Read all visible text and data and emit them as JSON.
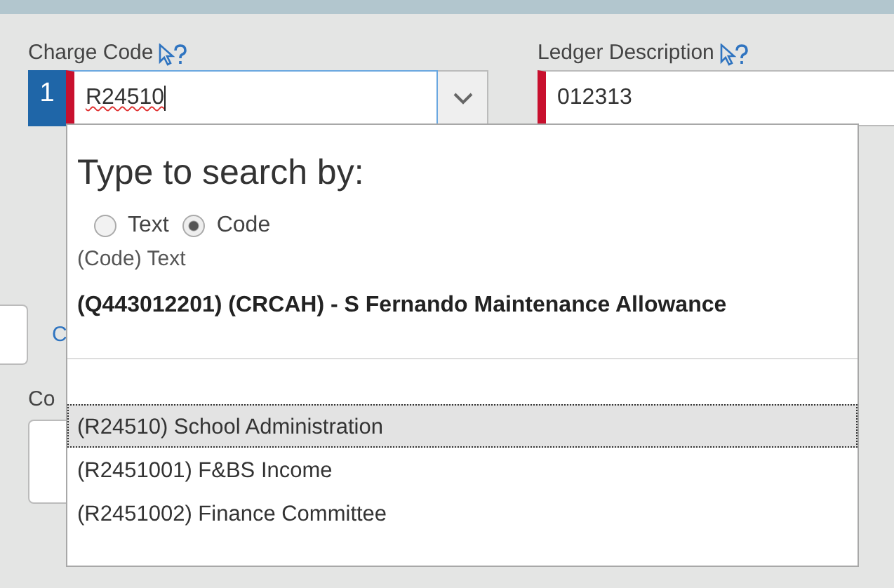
{
  "fields": [
    {
      "label": "Charge Code",
      "row_number": "1",
      "value": "R24510",
      "kind": "combo"
    },
    {
      "label": "Ledger Description",
      "value": "012313",
      "kind": "text"
    }
  ],
  "behind": {
    "link": "C",
    "label": "Co"
  },
  "dropdown": {
    "title": "Type to search by:",
    "options": [
      {
        "label": "Text",
        "selected": false
      },
      {
        "label": "Code",
        "selected": true
      }
    ],
    "format_hint": "(Code) Text",
    "header_item": "(Q443012201) (CRCAH) - S Fernando Maintenance Allowance",
    "items": [
      {
        "text": "(R24510) School Administration",
        "selected": true
      },
      {
        "text": "(R2451001) F&BS Income",
        "selected": false
      },
      {
        "text": "(R2451002) Finance Committee",
        "selected": false
      }
    ]
  }
}
